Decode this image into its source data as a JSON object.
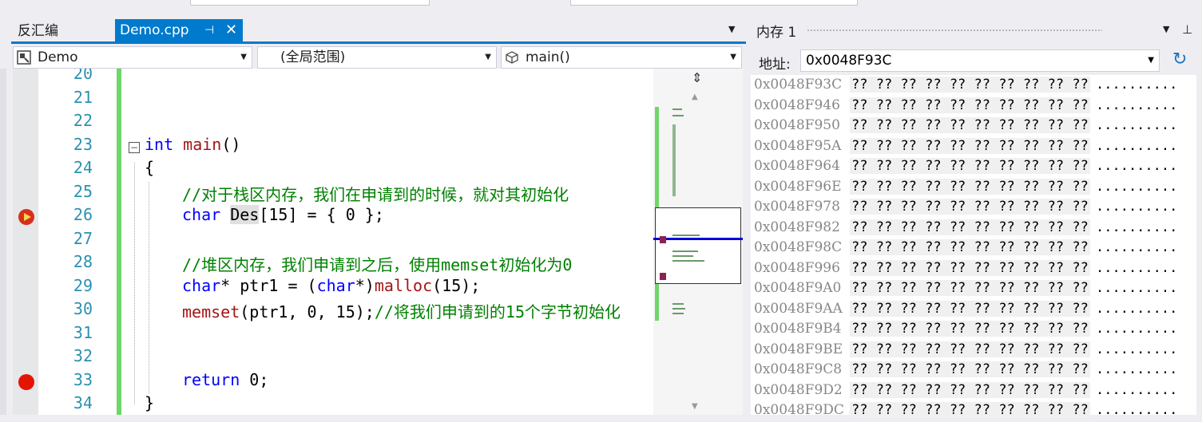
{
  "tabs": {
    "disasm": "反汇编",
    "active": "Demo.cpp",
    "pin": "⊣",
    "close": "✕",
    "overflow": "▼"
  },
  "nav": {
    "project": "Demo",
    "scope": "(全局范围)",
    "function": "main()"
  },
  "editor": {
    "lines": [
      {
        "num": "20",
        "code": ""
      },
      {
        "num": "21",
        "code": ""
      },
      {
        "num": "22",
        "code": ""
      },
      {
        "num": "23",
        "code": "int main()"
      },
      {
        "num": "24",
        "code": "{"
      },
      {
        "num": "25",
        "code": "//对于栈区内存，我们在申请到的时候，就对其初始化"
      },
      {
        "num": "26",
        "code": "char Des[15] = { 0 };"
      },
      {
        "num": "27",
        "code": ""
      },
      {
        "num": "28",
        "code": "//堆区内存，我们申请到之后，使用memset初始化为0"
      },
      {
        "num": "29",
        "code": "char* ptr1 = (char*)malloc(15);"
      },
      {
        "num": "30",
        "code": "memset(ptr1, 0, 15);//将我们申请到的15个字节初始化"
      },
      {
        "num": "31",
        "code": ""
      },
      {
        "num": "32",
        "code": ""
      },
      {
        "num": "33",
        "code": "return 0;"
      },
      {
        "num": "34",
        "code": "}"
      }
    ],
    "tokens": {
      "int": "int",
      "main": "main",
      "parens": "()",
      "brace_open": "{",
      "brace_close": "}",
      "cm25": "//对于栈区内存，我们在申请到的时候，就对其初始化",
      "char": "char",
      "des": "Des",
      "rest26": "[15] = { 0 };",
      "cm28": "//堆区内存，我们申请到之后，使用memset初始化为0",
      "char29a": "char",
      "mid29a": "* ptr1 = (",
      "char29b": "char",
      "mid29b": "*)",
      "malloc": "malloc",
      "rest29": "(15);",
      "memset": "memset",
      "rest30": "(ptr1, 0, 15);",
      "cm30": "//将我们申请到的15个字节初始化",
      "return": "return",
      "rest33": " 0;"
    }
  },
  "memory": {
    "title": "内存 1",
    "address_label": "地址:",
    "address_value": "0x0048F93C",
    "rows": [
      {
        "addr": "0x0048F93C",
        "bytes": "?? ?? ?? ?? ?? ?? ?? ?? ?? ??",
        "ascii": ".........."
      },
      {
        "addr": "0x0048F946",
        "bytes": "?? ?? ?? ?? ?? ?? ?? ?? ?? ??",
        "ascii": ".........."
      },
      {
        "addr": "0x0048F950",
        "bytes": "?? ?? ?? ?? ?? ?? ?? ?? ?? ??",
        "ascii": ".........."
      },
      {
        "addr": "0x0048F95A",
        "bytes": "?? ?? ?? ?? ?? ?? ?? ?? ?? ??",
        "ascii": ".........."
      },
      {
        "addr": "0x0048F964",
        "bytes": "?? ?? ?? ?? ?? ?? ?? ?? ?? ??",
        "ascii": ".........."
      },
      {
        "addr": "0x0048F96E",
        "bytes": "?? ?? ?? ?? ?? ?? ?? ?? ?? ??",
        "ascii": ".........."
      },
      {
        "addr": "0x0048F978",
        "bytes": "?? ?? ?? ?? ?? ?? ?? ?? ?? ??",
        "ascii": ".........."
      },
      {
        "addr": "0x0048F982",
        "bytes": "?? ?? ?? ?? ?? ?? ?? ?? ?? ??",
        "ascii": ".........."
      },
      {
        "addr": "0x0048F98C",
        "bytes": "?? ?? ?? ?? ?? ?? ?? ?? ?? ??",
        "ascii": ".........."
      },
      {
        "addr": "0x0048F996",
        "bytes": "?? ?? ?? ?? ?? ?? ?? ?? ?? ??",
        "ascii": ".........."
      },
      {
        "addr": "0x0048F9A0",
        "bytes": "?? ?? ?? ?? ?? ?? ?? ?? ?? ??",
        "ascii": ".........."
      },
      {
        "addr": "0x0048F9AA",
        "bytes": "?? ?? ?? ?? ?? ?? ?? ?? ?? ??",
        "ascii": ".........."
      },
      {
        "addr": "0x0048F9B4",
        "bytes": "?? ?? ?? ?? ?? ?? ?? ?? ?? ??",
        "ascii": ".........."
      },
      {
        "addr": "0x0048F9BE",
        "bytes": "?? ?? ?? ?? ?? ?? ?? ?? ?? ??",
        "ascii": ".........."
      },
      {
        "addr": "0x0048F9C8",
        "bytes": "?? ?? ?? ?? ?? ?? ?? ?? ?? ??",
        "ascii": ".........."
      },
      {
        "addr": "0x0048F9D2",
        "bytes": "?? ?? ?? ?? ?? ?? ?? ?? ?? ??",
        "ascii": ".........."
      },
      {
        "addr": "0x0048F9DC",
        "bytes": "?? ?? ?? ?? ?? ?? ?? ?? ?? ??",
        "ascii": ".........."
      }
    ]
  },
  "colors": {
    "accent": "#007acc",
    "keyword": "#0000ff",
    "function": "#a31515",
    "comment": "#008000",
    "line_number": "#2b91af",
    "breakpoint": "#e51400",
    "change_bar": "#6fd669"
  },
  "icons": {
    "project": "class-icon",
    "function": "cube-icon",
    "breakpoint": "breakpoint-icon",
    "current_statement": "current-statement-arrow-icon",
    "refresh": "refresh-icon",
    "pin": "pin-icon"
  }
}
